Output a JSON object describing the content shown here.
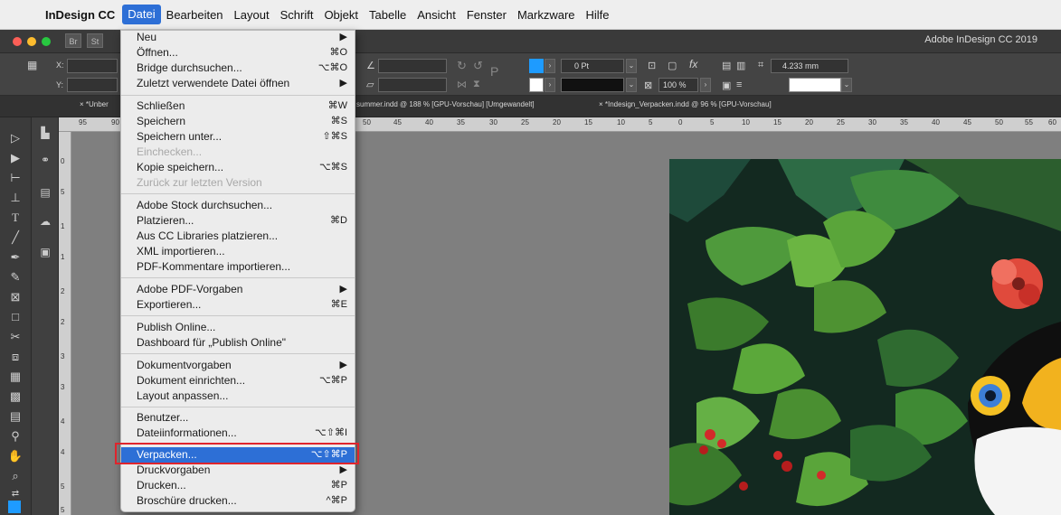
{
  "menubar": {
    "apple_icon": "apple-logo-icon",
    "items": [
      "InDesign CC",
      "Datei",
      "Bearbeiten",
      "Layout",
      "Schrift",
      "Objekt",
      "Tabelle",
      "Ansicht",
      "Fenster",
      "Markzware",
      "Hilfe"
    ],
    "active": "Datei"
  },
  "titlebar": {
    "badges": [
      "Br",
      "St"
    ],
    "app_title": "Adobe InDesign CC 2019"
  },
  "controlbar": {
    "x_label": "X:",
    "y_label": "Y:",
    "stroke_weight": "0 Pt",
    "opacity": "100 %",
    "dimension": "4.233 mm"
  },
  "tabs": [
    "× *Unber",
    "summer.indd @ 188 % [GPU-Vorschau] [Umgewandelt]",
    "× *Indesign_Verpacken.indd @ 96 % [GPU-Vorschau]"
  ],
  "ruler": {
    "numbers": [
      "95",
      "90",
      "50",
      "45",
      "40",
      "35",
      "30",
      "25",
      "20",
      "15",
      "10",
      "5",
      "0",
      "5",
      "10",
      "15",
      "20",
      "25",
      "30",
      "35",
      "40",
      "45",
      "50",
      "55",
      "60"
    ],
    "vertical": [
      "0",
      "5",
      "1",
      "1",
      "2",
      "2",
      "3",
      "3",
      "4",
      "4",
      "5",
      "5"
    ]
  },
  "file_menu": {
    "items": [
      {
        "label": "Neu",
        "shortcut": "▶"
      },
      {
        "label": "Öffnen...",
        "shortcut": "⌘O"
      },
      {
        "label": "Bridge durchsuchen...",
        "shortcut": "⌥⌘O"
      },
      {
        "label": "Zuletzt verwendete Datei öffnen",
        "shortcut": "▶"
      },
      {
        "label": "Schließen",
        "shortcut": "⌘W"
      },
      {
        "label": "Speichern",
        "shortcut": "⌘S"
      },
      {
        "label": "Speichern unter...",
        "shortcut": "⇧⌘S"
      },
      {
        "label": "Einchecken...",
        "shortcut": ""
      },
      {
        "label": "Kopie speichern...",
        "shortcut": "⌥⌘S"
      },
      {
        "label": "Zurück zur letzten Version",
        "shortcut": ""
      },
      {
        "label": "Adobe Stock durchsuchen...",
        "shortcut": ""
      },
      {
        "label": "Platzieren...",
        "shortcut": "⌘D"
      },
      {
        "label": "Aus CC Libraries platzieren...",
        "shortcut": ""
      },
      {
        "label": "XML importieren...",
        "shortcut": ""
      },
      {
        "label": "PDF-Kommentare importieren...",
        "shortcut": ""
      },
      {
        "label": "Adobe PDF-Vorgaben",
        "shortcut": "▶"
      },
      {
        "label": "Exportieren...",
        "shortcut": "⌘E"
      },
      {
        "label": "Publish Online...",
        "shortcut": ""
      },
      {
        "label": "Dashboard für „Publish Online\"",
        "shortcut": ""
      },
      {
        "label": "Dokumentvorgaben",
        "shortcut": "▶"
      },
      {
        "label": "Dokument einrichten...",
        "shortcut": "⌥⌘P"
      },
      {
        "label": "Layout anpassen...",
        "shortcut": ""
      },
      {
        "label": "Benutzer...",
        "shortcut": ""
      },
      {
        "label": "Dateiinformationen...",
        "shortcut": "⌥⇧⌘I"
      },
      {
        "label": "Verpacken...",
        "shortcut": "⌥⇧⌘P"
      },
      {
        "label": "Druckvorgaben",
        "shortcut": "▶"
      },
      {
        "label": "Drucken...",
        "shortcut": "⌘P"
      },
      {
        "label": "Broschüre drucken...",
        "shortcut": "^⌘P"
      }
    ]
  },
  "colors": {
    "highlight": "#2d6fd6",
    "callout": "#e0242c"
  }
}
